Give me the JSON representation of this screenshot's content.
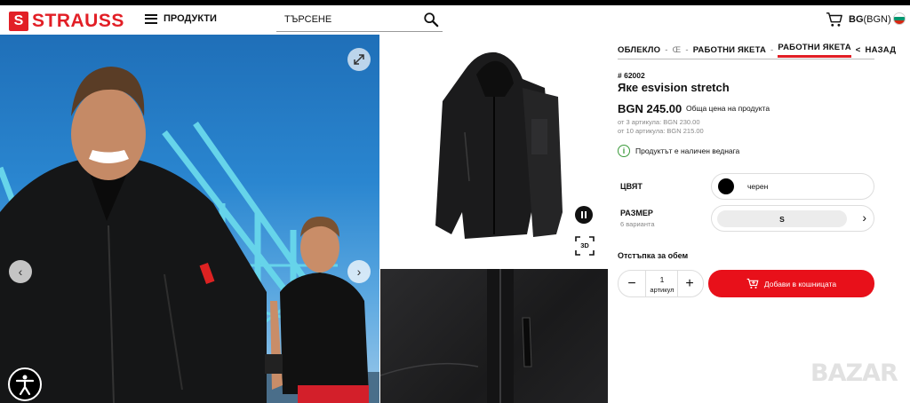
{
  "header": {
    "logo_mark": "S",
    "logo_text": "STRAUSS",
    "menu_label": "ПРОДУКТИ",
    "search_placeholder": "ТЪРСЕНЕ",
    "lang_code": "BG",
    "currency": "(BGN)"
  },
  "gallery": {
    "prev_icon": "‹",
    "next_icon": "›",
    "badge_3d": "3D"
  },
  "breadcrumb": {
    "items": [
      "ОБЛЕКЛО",
      "Œ",
      "РАБОТНИ ЯКЕТА",
      "РАБОТНИ ЯКЕТА"
    ],
    "separators": [
      "-",
      "-",
      "-"
    ],
    "back_label": "НАЗАД"
  },
  "product": {
    "sku": "# 62002",
    "title": "Яке esvision stretch",
    "price": "BGN 245.00",
    "price_note": "Обща цена на продукта",
    "tiers": [
      "от 3 артикула: BGN 230.00",
      "от 10 артикула: BGN 215.00"
    ],
    "stock": "Продуктът е наличен веднага"
  },
  "options": {
    "color_label": "ЦВЯТ",
    "color_value": "черен",
    "size_label": "РАЗМЕР",
    "size_sub": "6 варианта",
    "size_value": "S"
  },
  "purchase": {
    "volume_label": "Отстъпка за обем",
    "qty_value": "1",
    "qty_unit": "артикул",
    "minus": "−",
    "plus": "+",
    "add_label": "Добави в кошницата"
  },
  "watermark": "BAZAR",
  "colors": {
    "brand_red": "#e21f26",
    "cart_red": "#e8101a",
    "stock_green": "#3a9a3a"
  }
}
